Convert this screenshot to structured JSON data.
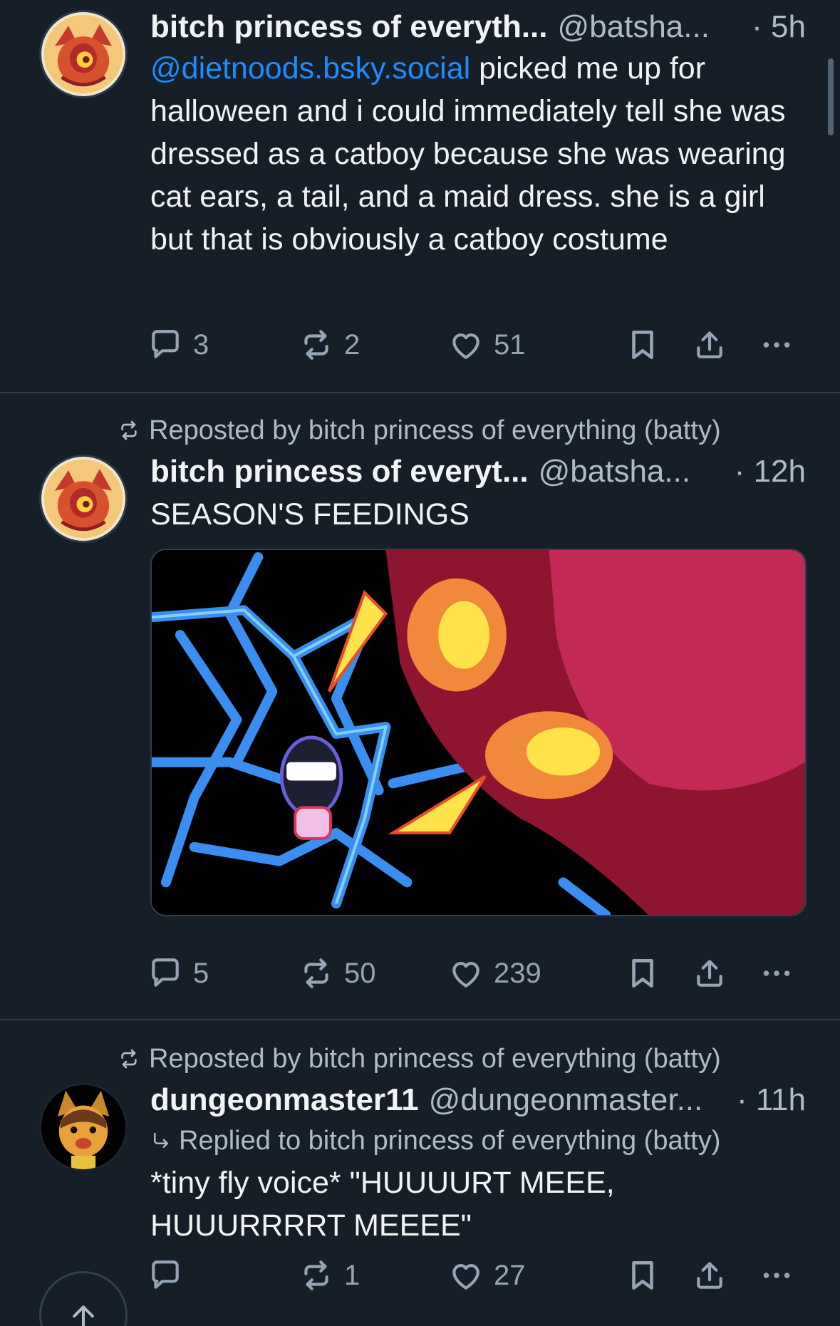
{
  "colors": {
    "background": "#161e27",
    "text": "#f1f3f5",
    "muted": "#aebbc9",
    "link": "#208bfe",
    "divider": "#2e4052"
  },
  "posts": [
    {
      "display_name": "bitch princess of everyth...",
      "handle": "@batsha...",
      "time": "· 5h",
      "mention": "@dietnoods.bsky.social",
      "text": " picked me up for halloween and i could immediately tell she was dressed as a catboy because she was wearing cat ears, a tail, and a maid dress. she is a girl but that is obviously a catboy costume",
      "reply_count": "3",
      "repost_count": "2",
      "like_count": "51"
    },
    {
      "repost_label": "Reposted by bitch princess of everything (batty)",
      "display_name": "bitch princess of everyt...",
      "handle": "@batsha...",
      "time": "· 12h",
      "text": "SEASON'S FEEDINGS",
      "reply_count": "5",
      "repost_count": "50",
      "like_count": "239"
    },
    {
      "repost_label": "Reposted by bitch princess of everything (batty)",
      "display_name": "dungeonmaster11",
      "handle": "@dungeonmaster...",
      "time": "· 11h",
      "reply_to": "Replied to bitch princess of everything (batty)",
      "text": "*tiny fly voice* \"HUUUURT MEEE, HUUURRRRT MEEEE\"",
      "reply_count": "",
      "repost_count": "1",
      "like_count": "27"
    }
  ],
  "icons": {
    "reply": "speech-bubble-icon",
    "repost": "repost-arrows-icon",
    "like": "heart-icon",
    "bookmark": "bookmark-icon",
    "share": "share-icon",
    "more": "more-dots-icon",
    "scroll_top": "arrow-up-icon"
  }
}
